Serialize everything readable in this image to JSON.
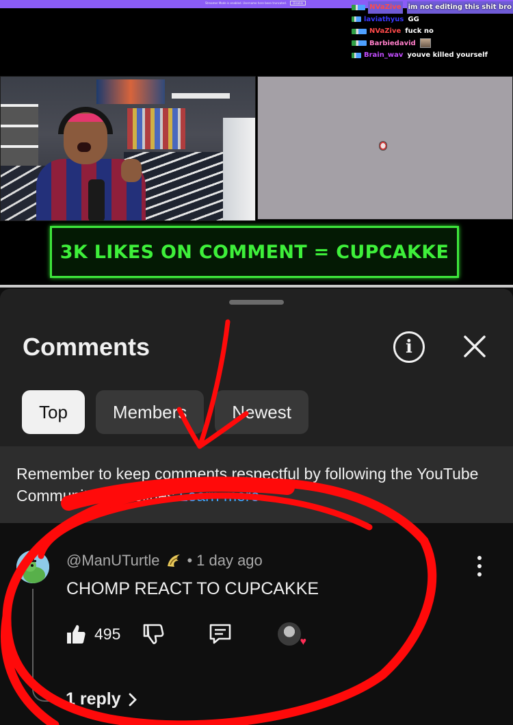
{
  "stream": {
    "banner_text": "Streamer Mode is enabled. Username here been truncated.",
    "banner_button": "Disable",
    "chat": [
      {
        "name": "NVaZive",
        "message": "im not editing this shit bro",
        "color": "#ff4a4a"
      },
      {
        "name": "laviathyus",
        "message": "GG",
        "color": "#3a38ff"
      },
      {
        "name": "NVaZive",
        "message": "fuck no",
        "color": "#ff4a4a"
      },
      {
        "name": "Barbiedavid",
        "message": "",
        "color": "#ff7ec9"
      },
      {
        "name": "Brain_wav",
        "message": "youve killed yourself",
        "color": "#c34dff"
      }
    ],
    "promo_text": "3K LIKES ON COMMENT = CUPCAKKE"
  },
  "comments_panel": {
    "title": "Comments",
    "info_icon": "info-icon",
    "close_icon": "close-icon",
    "filters": [
      {
        "label": "Top",
        "active": true
      },
      {
        "label": "Members",
        "active": false
      },
      {
        "label": "Newest",
        "active": false
      }
    ],
    "notice": {
      "text": "Remember to keep comments respectful by following the YouTube Community Guidelines ",
      "link": "Learn more"
    },
    "comment": {
      "author": "@ManUTurtle",
      "separator": "•",
      "time": "1 day ago",
      "text": "CHOMP REACT TO CUPCAKKE",
      "likes": "495",
      "replies_label": "1 reply"
    }
  },
  "colors": {
    "background": "#0f0f0f",
    "sheet": "#212121",
    "link": "#3ea6ff",
    "promo_green": "#3ef03a",
    "annotation_red": "#ff0a0a"
  }
}
